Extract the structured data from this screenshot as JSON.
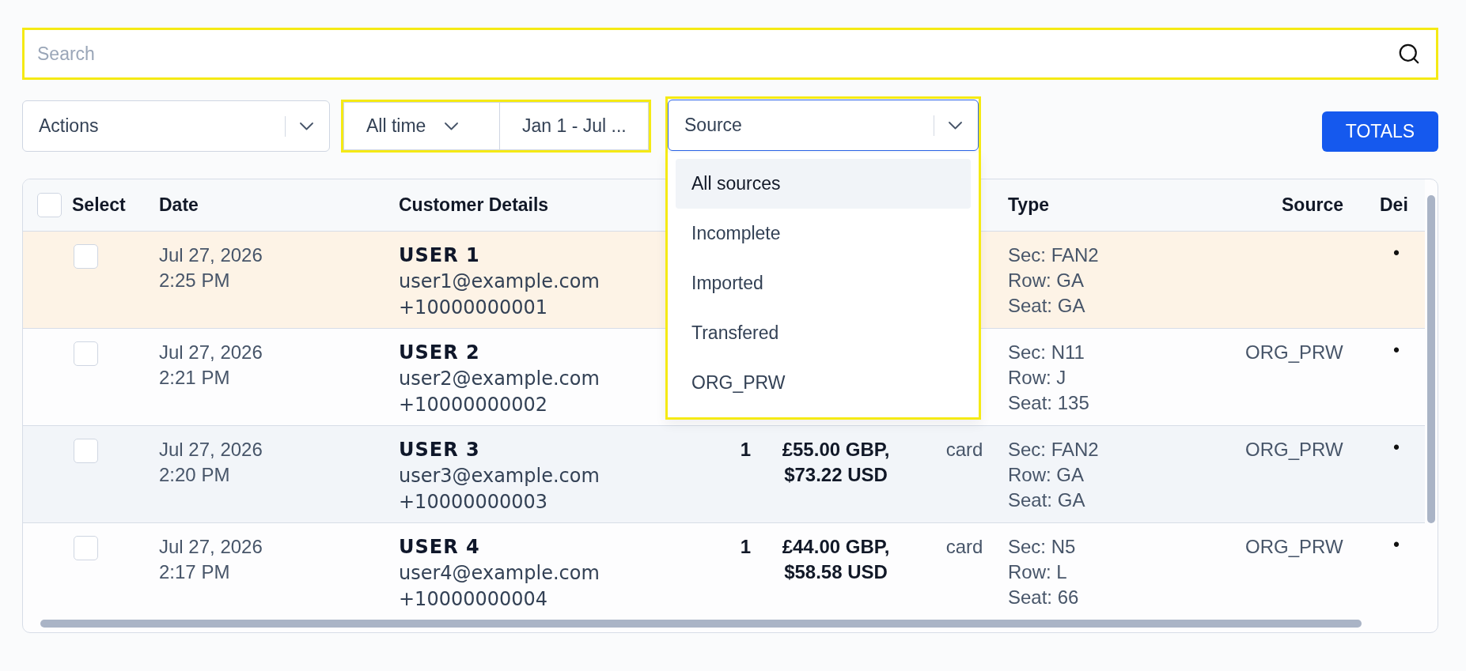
{
  "search": {
    "placeholder": "Search",
    "highlighted": true
  },
  "actions": {
    "label": "Actions"
  },
  "date_filter": {
    "range": "All time",
    "dates": "Jan 1 - Jul ...",
    "highlighted": true
  },
  "source_filter": {
    "label": "Source",
    "highlighted": true,
    "expanded": true,
    "options": [
      {
        "label": "All sources",
        "selected": true
      },
      {
        "label": "Incomplete",
        "selected": false
      },
      {
        "label": "Imported",
        "selected": false
      },
      {
        "label": "Transfered",
        "selected": false
      },
      {
        "label": "ORG_PRW",
        "selected": false
      }
    ]
  },
  "totals_button": "TOTALS",
  "table": {
    "select_all": {
      "checked": false
    },
    "header": {
      "select": "Select",
      "date": "Date",
      "customer": "Customer Details",
      "type": "Type",
      "source": "Source",
      "column_9": "Dei"
    },
    "rows": [
      {
        "checked": false,
        "highlighted": true,
        "date": "Jul 27, 2026",
        "time": "2:25 PM",
        "name": "USER 1",
        "email": "user1@example.com",
        "phone": "+10000000001",
        "type": [
          "Sec: FAN2",
          "Row: GA",
          "Seat: GA"
        ],
        "column_9": "•"
      },
      {
        "checked": false,
        "highlighted": false,
        "date": "Jul 27, 2026",
        "time": "2:21 PM",
        "name": "USER 2",
        "email": "user2@example.com",
        "phone": "+10000000002",
        "type": [
          "Sec: N11",
          "Row: J",
          "Seat: 135"
        ],
        "source": "ORG_PRW",
        "column_9": "•"
      },
      {
        "checked": false,
        "highlighted": false,
        "date": "Jul 27, 2026",
        "time": "2:20 PM",
        "name": "USER 3",
        "email": "user3@example.com",
        "phone": "+10000000003",
        "quantity": "1",
        "price": [
          "£55.00 GBP,",
          "$73.22 USD"
        ],
        "payment": "card",
        "type": [
          "Sec: FAN2",
          "Row: GA",
          "Seat: GA"
        ],
        "source": "ORG_PRW",
        "column_9": "•"
      },
      {
        "checked": false,
        "highlighted": false,
        "date": "Jul 27, 2026",
        "time": "2:17 PM",
        "name": "USER 4",
        "email": "user4@example.com",
        "phone": "+10000000004",
        "quantity": "1",
        "price": [
          "£44.00 GBP,",
          "$58.58 USD"
        ],
        "payment": "card",
        "type": [
          "Sec: N5",
          "Row: L",
          "Seat: 66"
        ],
        "source": "ORG_PRW",
        "column_9": "•"
      }
    ]
  }
}
